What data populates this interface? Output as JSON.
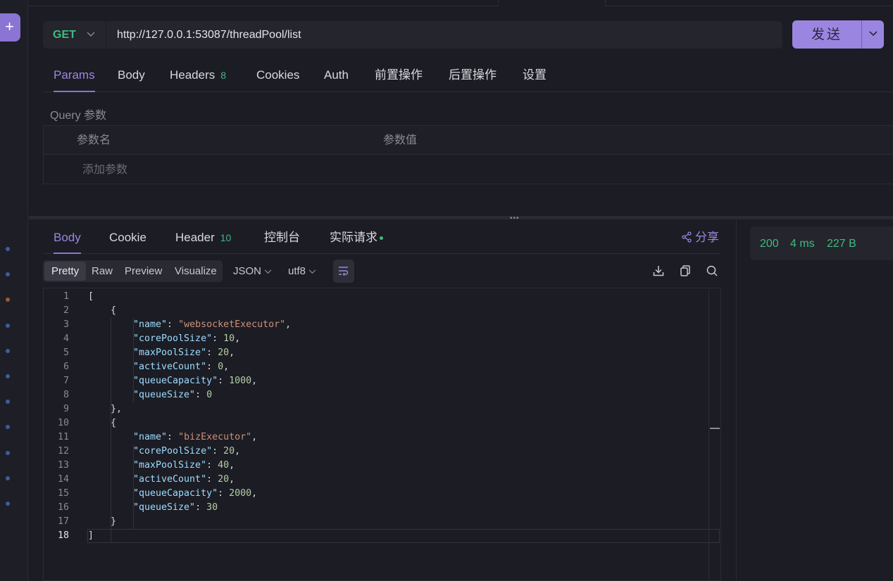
{
  "request": {
    "method": "GET",
    "url": "http://127.0.0.1:53087/threadPool/list",
    "send_label": "发送",
    "tabs": [
      {
        "label": "Params",
        "badge": ""
      },
      {
        "label": "Body",
        "badge": ""
      },
      {
        "label": "Headers",
        "badge": "8"
      },
      {
        "label": "Cookies",
        "badge": ""
      },
      {
        "label": "Auth",
        "badge": ""
      },
      {
        "label": "前置操作",
        "badge": ""
      },
      {
        "label": "后置操作",
        "badge": ""
      },
      {
        "label": "设置",
        "badge": ""
      }
    ],
    "query": {
      "title": "Query 参数",
      "col_name": "参数名",
      "col_value": "参数值",
      "add_placeholder": "添加参数"
    }
  },
  "response": {
    "tabs": [
      {
        "label": "Body",
        "badge": ""
      },
      {
        "label": "Cookie",
        "badge": ""
      },
      {
        "label": "Header",
        "badge": "10"
      },
      {
        "label": "控制台",
        "badge": ""
      },
      {
        "label": "实际请求",
        "badge": ""
      }
    ],
    "share_label": "分享",
    "view_modes": [
      "Pretty",
      "Raw",
      "Preview",
      "Visualize"
    ],
    "format": "JSON",
    "encoding": "utf8",
    "status": {
      "code": "200",
      "time": "4 ms",
      "size": "227 B"
    }
  },
  "icons": {
    "add": "plus-icon",
    "share": "share-icon",
    "wrap": "wrap-lines-icon",
    "download": "download-icon",
    "copy": "copy-icon",
    "search": "search-icon"
  },
  "colors": {
    "accent": "#8a74d4",
    "success": "#3dbd7d",
    "json_key": "#9cdcfe",
    "json_string": "#ce9178",
    "json_number": "#b5cea8"
  },
  "code_lines": [
    {
      "n": "1",
      "indent": 0,
      "parts": [
        [
          "p",
          "["
        ]
      ]
    },
    {
      "n": "2",
      "indent": 1,
      "parts": [
        [
          "p",
          "{"
        ]
      ]
    },
    {
      "n": "3",
      "indent": 2,
      "parts": [
        [
          "k",
          "\"name\""
        ],
        [
          "p",
          ": "
        ],
        [
          "s",
          "\"websocketExecutor\""
        ],
        [
          "p",
          ","
        ]
      ]
    },
    {
      "n": "4",
      "indent": 2,
      "parts": [
        [
          "k",
          "\"corePoolSize\""
        ],
        [
          "p",
          ": "
        ],
        [
          "n",
          "10"
        ],
        [
          "p",
          ","
        ]
      ]
    },
    {
      "n": "5",
      "indent": 2,
      "parts": [
        [
          "k",
          "\"maxPoolSize\""
        ],
        [
          "p",
          ": "
        ],
        [
          "n",
          "20"
        ],
        [
          "p",
          ","
        ]
      ]
    },
    {
      "n": "6",
      "indent": 2,
      "parts": [
        [
          "k",
          "\"activeCount\""
        ],
        [
          "p",
          ": "
        ],
        [
          "n",
          "0"
        ],
        [
          "p",
          ","
        ]
      ]
    },
    {
      "n": "7",
      "indent": 2,
      "parts": [
        [
          "k",
          "\"queueCapacity\""
        ],
        [
          "p",
          ": "
        ],
        [
          "n",
          "1000"
        ],
        [
          "p",
          ","
        ]
      ]
    },
    {
      "n": "8",
      "indent": 2,
      "parts": [
        [
          "k",
          "\"queueSize\""
        ],
        [
          "p",
          ": "
        ],
        [
          "n",
          "0"
        ]
      ]
    },
    {
      "n": "9",
      "indent": 1,
      "parts": [
        [
          "p",
          "},"
        ]
      ]
    },
    {
      "n": "10",
      "indent": 1,
      "parts": [
        [
          "p",
          "{"
        ]
      ]
    },
    {
      "n": "11",
      "indent": 2,
      "parts": [
        [
          "k",
          "\"name\""
        ],
        [
          "p",
          ": "
        ],
        [
          "s",
          "\"bizExecutor\""
        ],
        [
          "p",
          ","
        ]
      ]
    },
    {
      "n": "12",
      "indent": 2,
      "parts": [
        [
          "k",
          "\"corePoolSize\""
        ],
        [
          "p",
          ": "
        ],
        [
          "n",
          "20"
        ],
        [
          "p",
          ","
        ]
      ]
    },
    {
      "n": "13",
      "indent": 2,
      "parts": [
        [
          "k",
          "\"maxPoolSize\""
        ],
        [
          "p",
          ": "
        ],
        [
          "n",
          "40"
        ],
        [
          "p",
          ","
        ]
      ]
    },
    {
      "n": "14",
      "indent": 2,
      "parts": [
        [
          "k",
          "\"activeCount\""
        ],
        [
          "p",
          ": "
        ],
        [
          "n",
          "20"
        ],
        [
          "p",
          ","
        ]
      ]
    },
    {
      "n": "15",
      "indent": 2,
      "parts": [
        [
          "k",
          "\"queueCapacity\""
        ],
        [
          "p",
          ": "
        ],
        [
          "n",
          "2000"
        ],
        [
          "p",
          ","
        ]
      ]
    },
    {
      "n": "16",
      "indent": 2,
      "parts": [
        [
          "k",
          "\"queueSize\""
        ],
        [
          "p",
          ": "
        ],
        [
          "n",
          "30"
        ]
      ]
    },
    {
      "n": "17",
      "indent": 1,
      "parts": [
        [
          "p",
          "}"
        ]
      ]
    },
    {
      "n": "18",
      "indent": 0,
      "parts": [
        [
          "p",
          "]"
        ]
      ]
    }
  ]
}
